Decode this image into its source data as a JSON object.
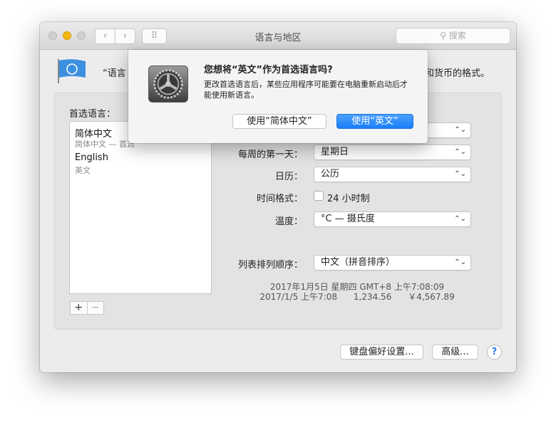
{
  "window": {
    "title": "语言与地区",
    "search_placeholder": "搜索",
    "back": "‹",
    "forward": "›",
    "grid": "⠿"
  },
  "description": {
    "left_fragment": "“语言",
    "right_fragment": "和货币的格式。"
  },
  "preferred": {
    "heading": "首选语言：",
    "items": [
      {
        "title": "简体中文",
        "subtitle": "简体中文 — 首选"
      },
      {
        "title": "English",
        "subtitle": "英文"
      }
    ],
    "add": "+",
    "remove": "−"
  },
  "settings": {
    "first_day_label": "每周的第一天：",
    "first_day": "星期日",
    "calendar_label": "日历：",
    "calendar": "公历",
    "time_format_label": "时间格式：",
    "time_24": "24 小时制",
    "time_24_checked": false,
    "temperature_label": "温度：",
    "temperature": "°C — 摄氏度",
    "sort_label": "列表排列顺序：",
    "sort": "中文（拼音排序）",
    "sample_line1": "2017年1月5日 星期四 GMT+8 上午7:08:09",
    "sample_line2": "2017/1/5 上午7:08      1,234.56      ￥4,567.89"
  },
  "buttons": {
    "keyboard": "键盘偏好设置...",
    "advanced": "高级...",
    "help": "?"
  },
  "dialog": {
    "title": "您想将“英文”作为首选语言吗?",
    "message": "更改首选语言后，某些应用程序可能要在电脑重新启动后才能使用新语言。",
    "secondary": "使用“简体中文”",
    "primary": "使用“英文”"
  },
  "colors": {
    "accent": "#1a82fb",
    "minimize": "#f5b80f"
  }
}
